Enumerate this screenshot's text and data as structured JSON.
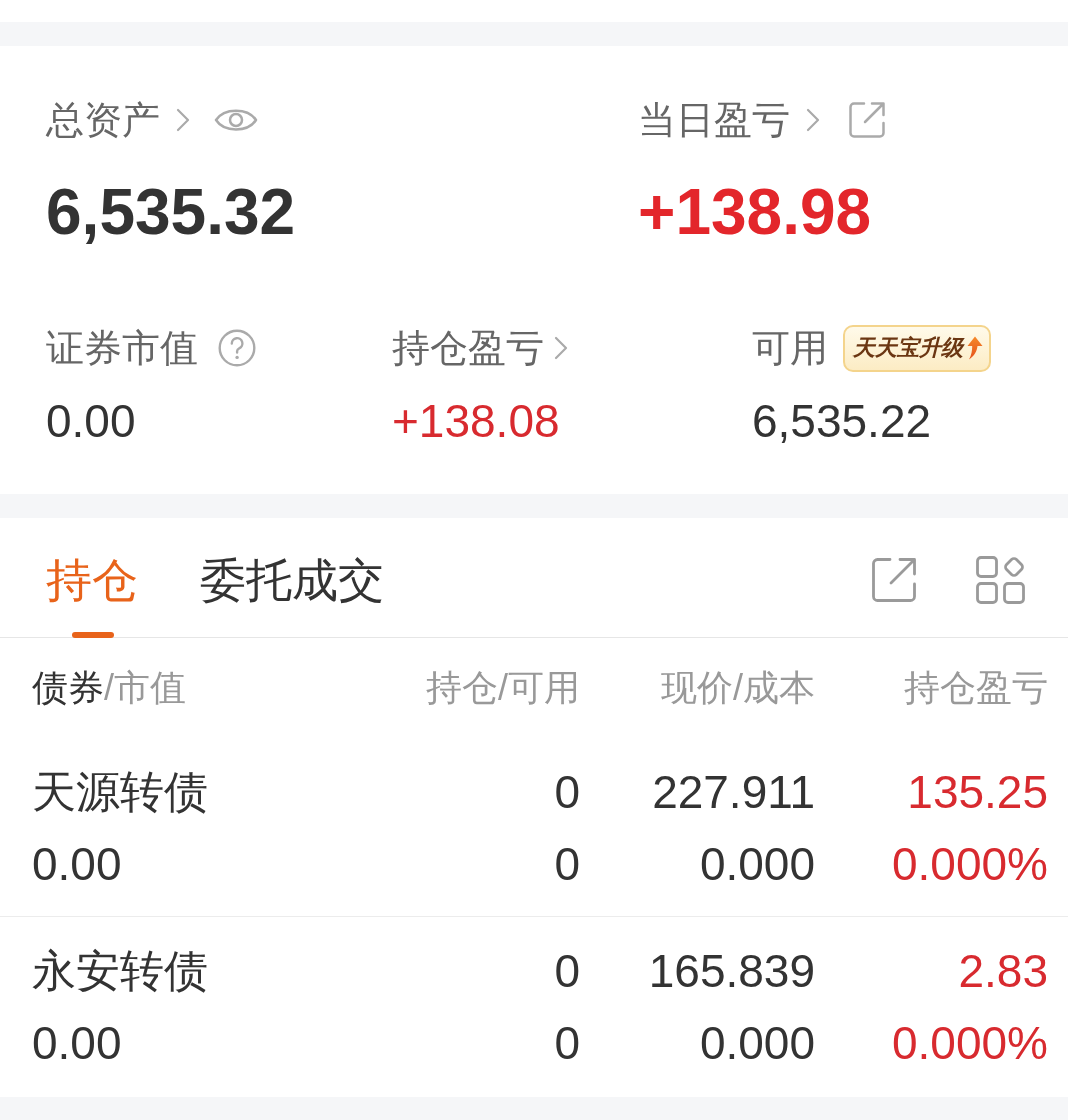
{
  "overview": {
    "primary": [
      {
        "label": "总资产",
        "kind": "visibility",
        "value": "6,535.32",
        "gain": false
      },
      {
        "label": "当日盈亏",
        "kind": "share",
        "value": "+138.98",
        "gain": true
      }
    ],
    "secondary": [
      {
        "label": "证券市值",
        "kind": "help",
        "value": "0.00",
        "gain": false
      },
      {
        "label": "持仓盈亏",
        "kind": "drill",
        "value": "+138.08",
        "gain": true
      },
      {
        "label": "可用",
        "kind": "promo",
        "badge": "天天宝升级",
        "value": "6,535.22",
        "gain": false
      }
    ]
  },
  "tabs": [
    {
      "label": "持仓",
      "selected": true
    },
    {
      "label": "委托成交",
      "selected": false
    }
  ],
  "table": {
    "columns": [
      {
        "label": "债券",
        "sub": "/市值"
      },
      {
        "label": "持仓/可用"
      },
      {
        "label": "现价/成本"
      },
      {
        "label": "持仓盈亏"
      }
    ],
    "rows": [
      {
        "name": "天源转债",
        "market_value": "0.00",
        "holding": "0",
        "available": "0",
        "price": "227.911",
        "cost": "0.000",
        "pnl": "135.25",
        "pnl_pct": "0.000%",
        "gain": true
      },
      {
        "name": "永安转债",
        "market_value": "0.00",
        "holding": "0",
        "available": "0",
        "price": "165.839",
        "cost": "0.000",
        "pnl": "2.83",
        "pnl_pct": "0.000%",
        "gain": true
      }
    ]
  }
}
